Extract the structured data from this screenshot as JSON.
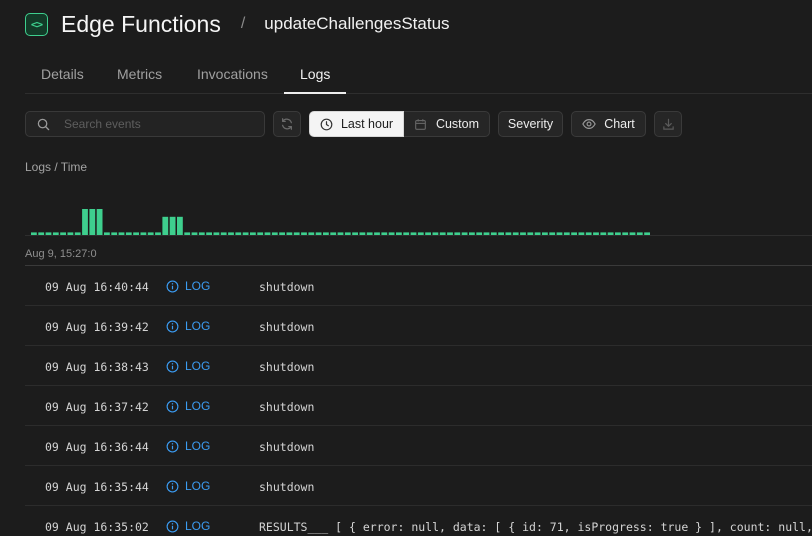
{
  "header": {
    "icon": "code-brackets-icon",
    "icon_glyph": "<>",
    "title": "Edge Functions",
    "separator": "/",
    "function_name": "updateChallengesStatus"
  },
  "tabs": [
    {
      "label": "Details",
      "active": false
    },
    {
      "label": "Metrics",
      "active": false
    },
    {
      "label": "Invocations",
      "active": false
    },
    {
      "label": "Logs",
      "active": true
    }
  ],
  "toolbar": {
    "search_placeholder": "Search events",
    "refresh_icon": "refresh-icon",
    "last_hour_label": "Last hour",
    "custom_label": "Custom",
    "severity_label": "Severity",
    "chart_label": "Chart",
    "download_icon": "download-icon"
  },
  "chart": {
    "title": "Logs / Time",
    "start_label": "Aug 9, 15:27:0",
    "color": "#3ecf8e"
  },
  "chart_data": {
    "type": "bar",
    "title": "Logs / Time",
    "xlabel": "Aug 9, 15:27:0",
    "ylabel": "",
    "values": [
      1,
      1,
      1,
      1,
      1,
      1,
      1,
      10,
      10,
      10,
      1,
      1,
      1,
      1,
      1,
      1,
      1,
      1,
      7,
      7,
      7,
      1,
      1,
      1,
      1,
      1,
      1,
      1,
      1,
      1,
      1,
      1,
      1,
      1,
      1,
      1,
      1,
      1,
      1,
      1,
      1,
      1,
      1,
      1,
      1,
      1,
      1,
      1,
      1,
      1,
      1,
      1,
      1,
      1,
      1,
      1,
      1,
      1,
      1,
      1,
      1,
      1,
      1,
      1,
      1,
      1,
      1,
      1,
      1,
      1,
      1,
      1,
      1,
      1,
      1,
      1,
      1,
      1,
      1,
      1,
      1,
      1,
      1,
      1,
      1
    ],
    "ylim": [
      0,
      10
    ]
  },
  "logs": [
    {
      "timestamp": "09 Aug 16:40:44",
      "level": "LOG",
      "message": "shutdown"
    },
    {
      "timestamp": "09 Aug 16:39:42",
      "level": "LOG",
      "message": "shutdown"
    },
    {
      "timestamp": "09 Aug 16:38:43",
      "level": "LOG",
      "message": "shutdown"
    },
    {
      "timestamp": "09 Aug 16:37:42",
      "level": "LOG",
      "message": "shutdown"
    },
    {
      "timestamp": "09 Aug 16:36:44",
      "level": "LOG",
      "message": "shutdown"
    },
    {
      "timestamp": "09 Aug 16:35:44",
      "level": "LOG",
      "message": "shutdown"
    },
    {
      "timestamp": "09 Aug 16:35:02",
      "level": "LOG",
      "message": "RESULTS___ [ { error: null, data: [ { id: 71, isProgress: true } ], count: null,"
    }
  ],
  "log_level_icon": "info-circle-icon"
}
